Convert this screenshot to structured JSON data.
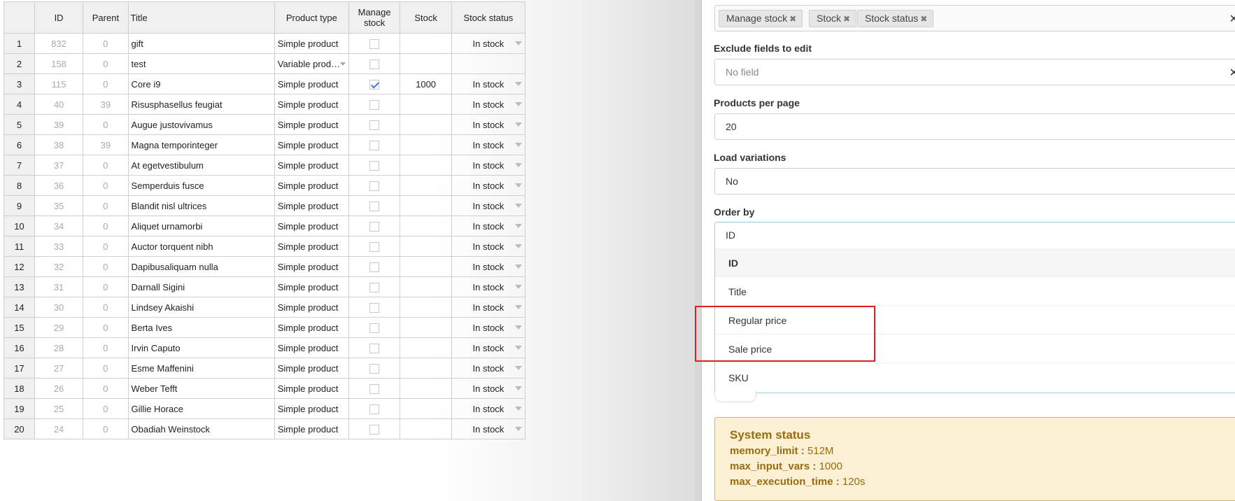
{
  "table": {
    "headers": {
      "id": "ID",
      "parent": "Parent",
      "title": "Title",
      "product_type": "Product type",
      "manage_stock_line1": "Manage",
      "manage_stock_line2": "stock",
      "stock": "Stock",
      "stock_status": "Stock status"
    },
    "rows": [
      {
        "n": "1",
        "id": "832",
        "parent": "0",
        "title": "gift",
        "type": "Simple product",
        "manage": false,
        "stock": "",
        "status": "In stock"
      },
      {
        "n": "2",
        "id": "158",
        "parent": "0",
        "title": "test",
        "type": "Variable prod…",
        "manage": false,
        "stock": "",
        "status": ""
      },
      {
        "n": "3",
        "id": "115",
        "parent": "0",
        "title": "Core i9",
        "type": "Simple product",
        "manage": true,
        "stock": "1000",
        "status": "In stock"
      },
      {
        "n": "4",
        "id": "40",
        "parent": "39",
        "title": "Risusphasellus feugiat",
        "type": "Simple product",
        "manage": false,
        "stock": "",
        "status": "In stock"
      },
      {
        "n": "5",
        "id": "39",
        "parent": "0",
        "title": "Augue justovivamus",
        "type": "Simple product",
        "manage": false,
        "stock": "",
        "status": "In stock"
      },
      {
        "n": "6",
        "id": "38",
        "parent": "39",
        "title": "Magna temporinteger",
        "type": "Simple product",
        "manage": false,
        "stock": "",
        "status": "In stock"
      },
      {
        "n": "7",
        "id": "37",
        "parent": "0",
        "title": "At egetvestibulum",
        "type": "Simple product",
        "manage": false,
        "stock": "",
        "status": "In stock"
      },
      {
        "n": "8",
        "id": "36",
        "parent": "0",
        "title": "Semperduis fusce",
        "type": "Simple product",
        "manage": false,
        "stock": "",
        "status": "In stock"
      },
      {
        "n": "9",
        "id": "35",
        "parent": "0",
        "title": "Blandit nisl ultrices",
        "type": "Simple product",
        "manage": false,
        "stock": "",
        "status": "In stock"
      },
      {
        "n": "10",
        "id": "34",
        "parent": "0",
        "title": "Aliquet urnamorbi",
        "type": "Simple product",
        "manage": false,
        "stock": "",
        "status": "In stock"
      },
      {
        "n": "11",
        "id": "33",
        "parent": "0",
        "title": "Auctor torquent nibh",
        "type": "Simple product",
        "manage": false,
        "stock": "",
        "status": "In stock"
      },
      {
        "n": "12",
        "id": "32",
        "parent": "0",
        "title": "Dapibusaliquam nulla",
        "type": "Simple product",
        "manage": false,
        "stock": "",
        "status": "In stock"
      },
      {
        "n": "13",
        "id": "31",
        "parent": "0",
        "title": "Darnall Sigini",
        "type": "Simple product",
        "manage": false,
        "stock": "",
        "status": "In stock"
      },
      {
        "n": "14",
        "id": "30",
        "parent": "0",
        "title": "Lindsey Akaishi",
        "type": "Simple product",
        "manage": false,
        "stock": "",
        "status": "In stock"
      },
      {
        "n": "15",
        "id": "29",
        "parent": "0",
        "title": "Berta Ives",
        "type": "Simple product",
        "manage": false,
        "stock": "",
        "status": "In stock"
      },
      {
        "n": "16",
        "id": "28",
        "parent": "0",
        "title": "Irvin Caputo",
        "type": "Simple product",
        "manage": false,
        "stock": "",
        "status": "In stock"
      },
      {
        "n": "17",
        "id": "27",
        "parent": "0",
        "title": "Esme Maffenini",
        "type": "Simple product",
        "manage": false,
        "stock": "",
        "status": "In stock"
      },
      {
        "n": "18",
        "id": "26",
        "parent": "0",
        "title": "Weber Tefft",
        "type": "Simple product",
        "manage": false,
        "stock": "",
        "status": "In stock"
      },
      {
        "n": "19",
        "id": "25",
        "parent": "0",
        "title": "Gillie Horace",
        "type": "Simple product",
        "manage": false,
        "stock": "",
        "status": "In stock"
      },
      {
        "n": "20",
        "id": "24",
        "parent": "0",
        "title": "Obadiah Weinstock",
        "type": "Simple product",
        "manage": false,
        "stock": "",
        "status": "In stock"
      }
    ]
  },
  "settings": {
    "selected_fields": [
      "Manage stock",
      "Stock",
      "Stock status"
    ],
    "tag_remove_glyph": "✖",
    "clear_glyph": "✕",
    "exclude_fields": {
      "label": "Exclude fields to edit",
      "placeholder": "No field"
    },
    "products_per_page": {
      "label": "Products per page",
      "value": "20"
    },
    "load_variations": {
      "label": "Load variations",
      "value": "No"
    },
    "order_by": {
      "label": "Order by",
      "value": "ID",
      "options": [
        "ID",
        "Title",
        "Regular price",
        "Sale price",
        "SKU"
      ],
      "selected_index": 0
    }
  },
  "system_status": {
    "title": "System status",
    "items": [
      {
        "key": "memory_limit",
        "sep": " : ",
        "value": "512M"
      },
      {
        "key": "max_input_vars",
        "sep": " : ",
        "value": "1000"
      },
      {
        "key": "max_execution_time",
        "sep": " : ",
        "value": "120s"
      }
    ]
  },
  "colors": {
    "highlight": "#e02020",
    "checkbox_check": "#3a78d8",
    "status_bg": "#fbf0d4",
    "status_text": "#9a6b10"
  }
}
